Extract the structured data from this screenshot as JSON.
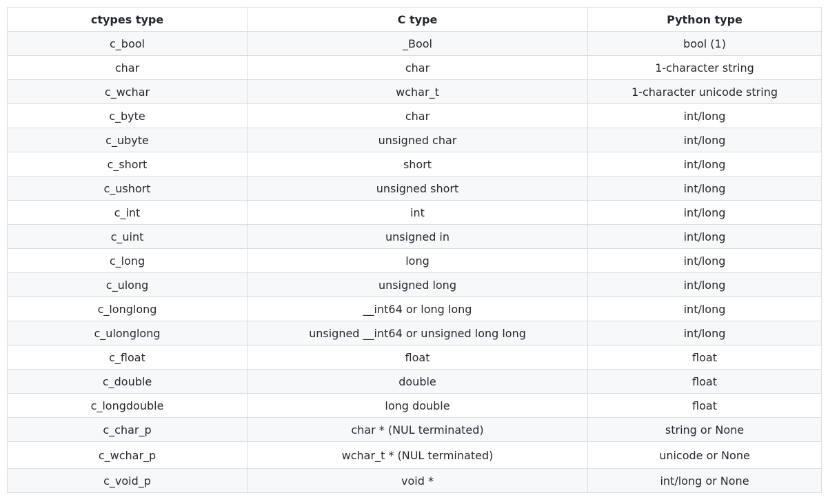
{
  "table": {
    "headers": [
      "ctypes type",
      "C type",
      "Python type"
    ],
    "rows": [
      [
        "c_bool",
        "_Bool",
        "bool (1)"
      ],
      [
        "char",
        "char",
        "1-character string"
      ],
      [
        "c_wchar",
        "wchar_t",
        "1-character unicode string"
      ],
      [
        "c_byte",
        "char",
        "int/long"
      ],
      [
        "c_ubyte",
        "unsigned char",
        "int/long"
      ],
      [
        "c_short",
        "short",
        "int/long"
      ],
      [
        "c_ushort",
        "unsigned short",
        "int/long"
      ],
      [
        "c_int",
        "int",
        "int/long"
      ],
      [
        "c_uint",
        "unsigned in",
        "int/long"
      ],
      [
        "c_long",
        "long",
        "int/long"
      ],
      [
        "c_ulong",
        "unsigned long",
        "int/long"
      ],
      [
        "c_longlong",
        "__int64 or long long",
        "int/long"
      ],
      [
        "c_ulonglong",
        "unsigned __int64 or unsigned long long",
        "int/long"
      ],
      [
        "c_float",
        "float",
        "float"
      ],
      [
        "c_double",
        "double",
        "float"
      ],
      [
        "c_longdouble",
        "long double",
        "float"
      ],
      [
        "c_char_p",
        "char * (NUL terminated)",
        "string or None"
      ],
      [
        "c_wchar_p",
        "wchar_t * (NUL terminated)",
        "unicode or None"
      ],
      [
        "c_void_p",
        "void *",
        "int/long or None"
      ]
    ]
  }
}
